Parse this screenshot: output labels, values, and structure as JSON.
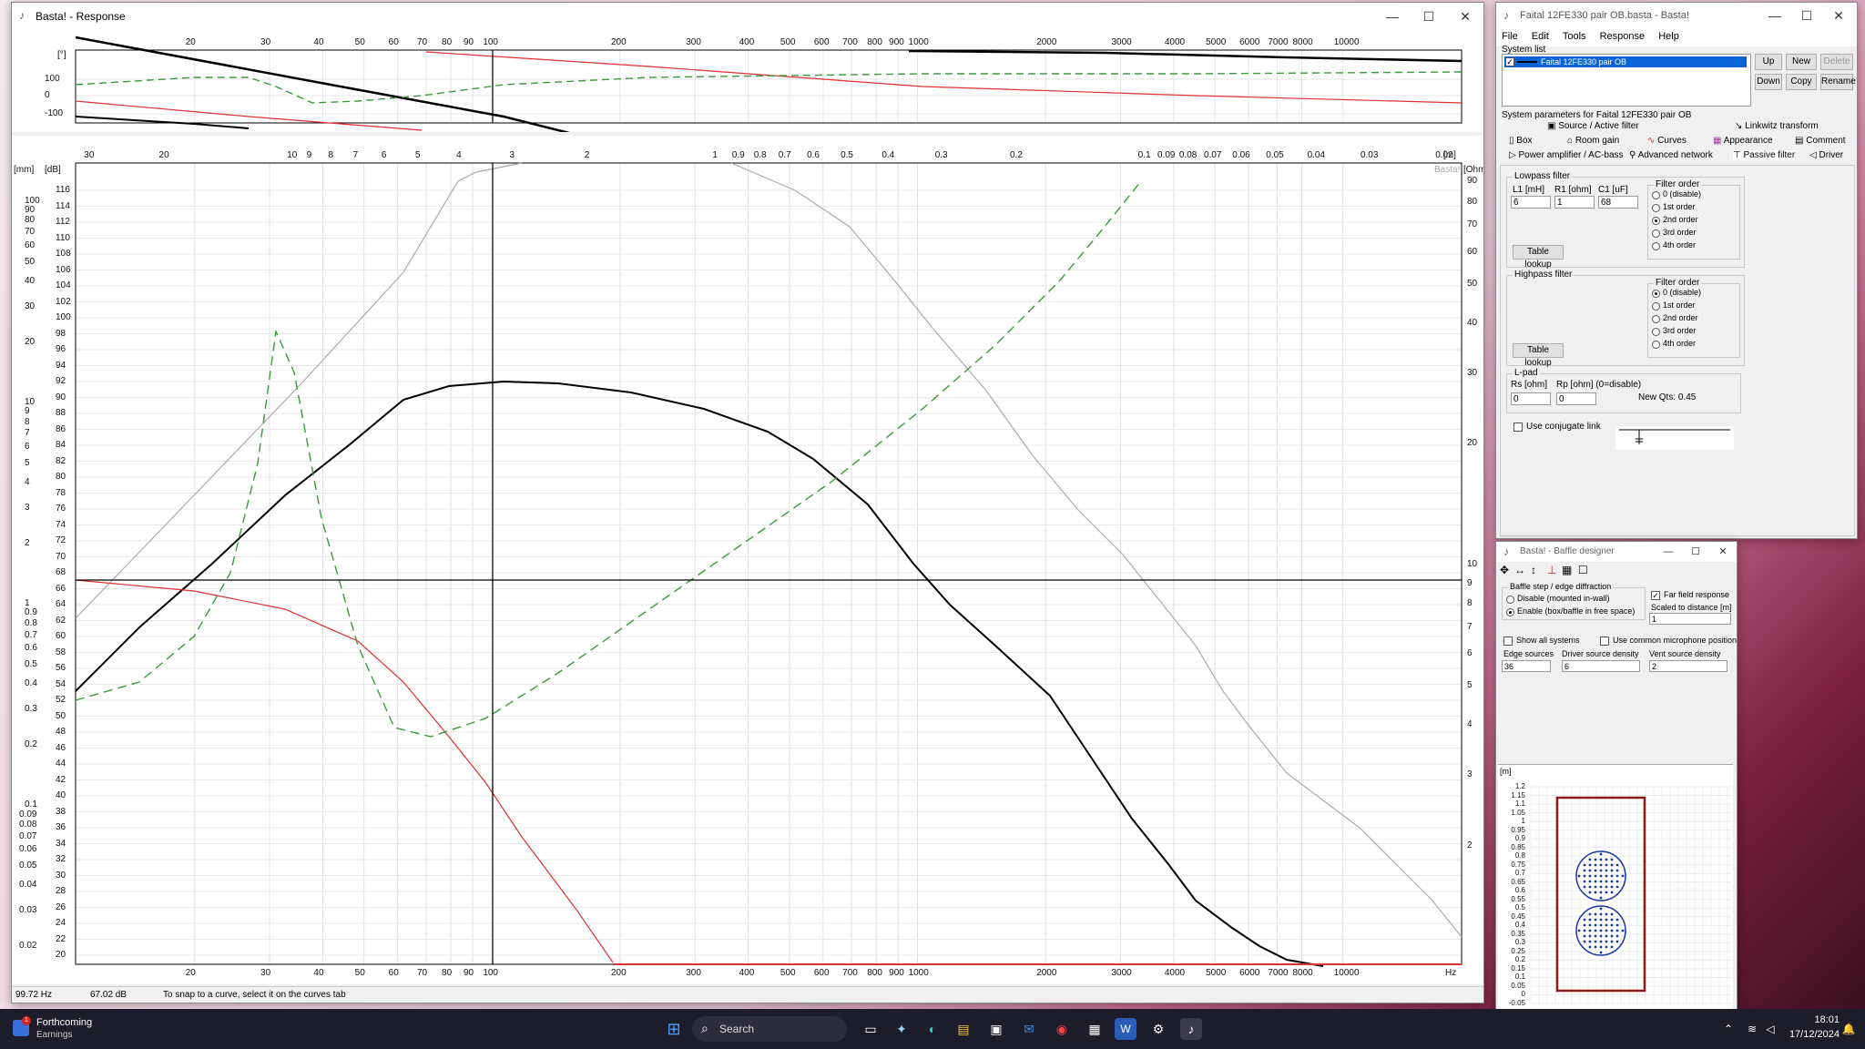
{
  "response_window": {
    "title": "Basta! - Response",
    "status": {
      "freq": "99.72 Hz",
      "level": "67.02 dB",
      "hint": "To snap to a curve, select it on the curves tab"
    },
    "phase_plot": {
      "unit_label": "[°]",
      "y_ticks": [
        "100",
        "0",
        "-100"
      ],
      "x_ticks": [
        "20",
        "30",
        "40",
        "50",
        "60",
        "70",
        "80",
        "90",
        "100",
        "200",
        "300",
        "400",
        "500",
        "600",
        "700",
        "800",
        "900",
        "1000",
        "2000",
        "3000",
        "4000",
        "5000",
        "6000",
        "7000",
        "8000",
        "10000"
      ]
    },
    "main_plot": {
      "top_axis_unit": "[m]",
      "top_axis_ticks": [
        "30",
        "20",
        "10",
        "9",
        "8",
        "7",
        "6",
        "5",
        "4",
        "3",
        "2",
        "1",
        "0.9",
        "0.8",
        "0.7",
        "0.6",
        "0.5",
        "0.4",
        "0.3",
        "0.2",
        "0.1",
        "0.09",
        "0.08",
        "0.07",
        "0.06",
        "0.05",
        "0.04",
        "0.03",
        "0.02"
      ],
      "left_mm_label": "[mm]",
      "left_mm_ticks": [
        "100",
        "90",
        "80",
        "70",
        "60",
        "50",
        "40",
        "30",
        "20",
        "10",
        "9",
        "8",
        "7",
        "6",
        "5",
        "4",
        "3",
        "2",
        "1",
        "0.9",
        "0.8",
        "0.7",
        "0.6",
        "0.5",
        "0.4",
        "0.3",
        "0.2",
        "0.1",
        "0.09",
        "0.08",
        "0.07",
        "0.06",
        "0.05",
        "0.04",
        "0.03",
        "0.02"
      ],
      "left_db_label": "[dB]",
      "left_db_ticks": [
        "116",
        "114",
        "112",
        "110",
        "108",
        "106",
        "104",
        "102",
        "100",
        "98",
        "96",
        "94",
        "92",
        "90",
        "88",
        "86",
        "84",
        "82",
        "80",
        "78",
        "76",
        "74",
        "72",
        "70",
        "68",
        "66",
        "64",
        "62",
        "60",
        "58",
        "56",
        "54",
        "52",
        "50",
        "48",
        "46",
        "44",
        "42",
        "40",
        "38",
        "36",
        "34",
        "32",
        "30",
        "28",
        "26",
        "24",
        "22",
        "20"
      ],
      "right_ohm_label": "[Ohm]",
      "right_ohm_ticks": [
        "90",
        "80",
        "70",
        "60",
        "50",
        "40",
        "30",
        "20",
        "10",
        "9",
        "8",
        "7",
        "6",
        "5",
        "4",
        "3",
        "2"
      ],
      "x_ticks": [
        "20",
        "30",
        "40",
        "50",
        "60",
        "70",
        "80",
        "90",
        "100",
        "200",
        "300",
        "400",
        "500",
        "600",
        "700",
        "800",
        "900",
        "1000",
        "2000",
        "3000",
        "4000",
        "5000",
        "6000",
        "7000",
        "8000",
        "10000"
      ],
      "x_unit": "Hz",
      "watermark": "Basta!"
    }
  },
  "system_window": {
    "title": "Faital 12FE330 pair OB.basta - Basta!",
    "menu": [
      "File",
      "Edit",
      "Tools",
      "Response",
      "Help"
    ],
    "system_list_label": "System list",
    "system_item": "Faital 12FE330 pair OB",
    "buttons": {
      "up": "Up",
      "new": "New",
      "delete": "Delete",
      "down": "Down",
      "copy": "Copy",
      "rename": "Rename"
    },
    "params_label": "System parameters for Faital 12FE330 pair OB",
    "tabs_row1": [
      "Source / Active filter",
      "Linkwitz transform"
    ],
    "tabs_row2": [
      "Box",
      "Room gain",
      "Curves",
      "Appearance",
      "Comment"
    ],
    "tabs_row3": [
      "Power amplifier / AC-bass",
      "Advanced network",
      "Passive filter",
      "Driver"
    ],
    "lowpass": {
      "title": "Lowpass filter",
      "l1_label": "L1 [mH]",
      "l1": "6",
      "r1_label": "R1 [ohm]",
      "r1": "1",
      "c1_label": "C1 [uF]",
      "c1": "68",
      "order_label": "Filter order",
      "orders": [
        "0 (disable)",
        "1st order",
        "2nd order",
        "3rd order",
        "4th order"
      ],
      "selected": 2,
      "lookup": "Table lookup"
    },
    "highpass": {
      "title": "Highpass filter",
      "order_label": "Filter order",
      "orders": [
        "0 (disable)",
        "1st order",
        "2nd order",
        "3rd order",
        "4th order"
      ],
      "selected": 0,
      "lookup": "Table lookup"
    },
    "lpad": {
      "title": "L-pad",
      "rs_label": "Rs [ohm]",
      "rs": "0",
      "rp_label": "Rp [ohm] (0=disable)",
      "rp": "0",
      "qts": "New Qts: 0.45"
    },
    "conjugate": "Use conjugate link"
  },
  "baffle_window": {
    "title": "Basta! - Baffle designer",
    "diffraction_title": "Baffle step / edge diffraction",
    "opt_disable": "Disable (mounted in-wall)",
    "opt_enable": "Enable (box/baffle in free space)",
    "far_field": "Far field response",
    "scaled": "Scaled to distance [m]",
    "distance": "1",
    "show_all": "Show all systems",
    "common_mic": "Use common microphone position",
    "edge_label": "Edge sources",
    "edge": "36",
    "driver_density_label": "Driver source density",
    "driver_density": "6",
    "vent_density_label": "Vent source density",
    "vent_density": "2",
    "y_unit": "[m]",
    "y_ticks": [
      "1.2",
      "1.15",
      "1.1",
      "1.05",
      "1",
      "0.95",
      "0.9",
      "0.85",
      "0.8",
      "0.75",
      "0.7",
      "0.65",
      "0.6",
      "0.55",
      "0.5",
      "0.45",
      "0.4",
      "0.35",
      "0.3",
      "0.25",
      "0.2",
      "0.15",
      "0.1",
      "0.05",
      "0",
      "-0.05"
    ]
  },
  "taskbar": {
    "news_title": "Forthcoming",
    "news_sub": "Earnings",
    "search": "Search",
    "time": "18:01",
    "date": "17/12/2024"
  }
}
